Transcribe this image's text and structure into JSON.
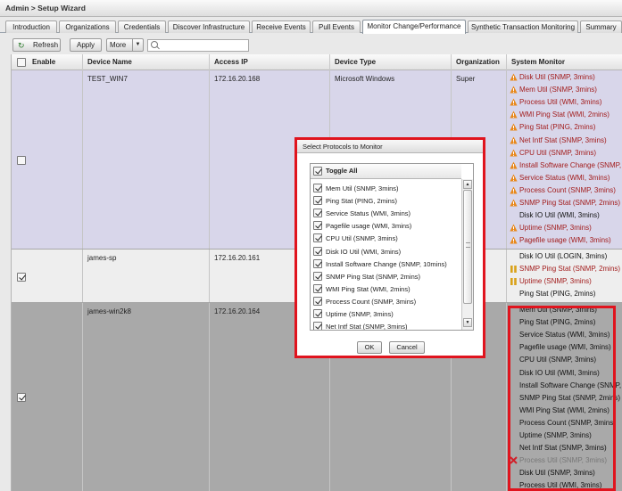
{
  "breadcrumb": "Admin > Setup Wizard",
  "tabs": [
    "Introduction",
    "Organizations",
    "Credentials",
    "Discover Infrastructure",
    "Receive Events",
    "Pull Events",
    "Monitor Change/Performance",
    "Synthetic Transaction Monitoring",
    "Summary"
  ],
  "active_tab": "Monitor Change/Performance",
  "toolbar": {
    "refresh_label": "Refresh",
    "apply_label": "Apply",
    "more_label": "More",
    "search_value": ""
  },
  "columns": {
    "enable": "Enable",
    "device_name": "Device Name",
    "access_ip": "Access IP",
    "device_type": "Device Type",
    "organization": "Organization",
    "system_monitor": "System Monitor"
  },
  "rows": [
    {
      "enabled": false,
      "device_name": "TEST_WIN7",
      "access_ip": "172.16.20.168",
      "device_type": "Microsoft Windows",
      "organization": "Super",
      "monitors": [
        {
          "label": "Disk Util (SNMP, 3mins)",
          "status": "warning"
        },
        {
          "label": "Mem Util (SNMP, 3mins)",
          "status": "warning"
        },
        {
          "label": "Process Util (WMI, 3mins)",
          "status": "warning"
        },
        {
          "label": "WMI Ping Stat (WMI, 2mins)",
          "status": "warning"
        },
        {
          "label": "Ping Stat (PING, 2mins)",
          "status": "warning"
        },
        {
          "label": "Net Intf Stat (SNMP, 3mins)",
          "status": "warning"
        },
        {
          "label": "CPU Util (SNMP, 3mins)",
          "status": "warning"
        },
        {
          "label": "Install Software Change (SNMP,",
          "status": "warning"
        },
        {
          "label": "Service Status (WMI, 3mins)",
          "status": "warning"
        },
        {
          "label": "Process Count (SNMP, 3mins)",
          "status": "warning"
        },
        {
          "label": "SNMP Ping Stat (SNMP, 2mins)",
          "status": "warning"
        },
        {
          "label": "Disk IO Util (WMI, 3mins)",
          "status": "ok"
        },
        {
          "label": "Uptime (SNMP, 3mins)",
          "status": "warning"
        },
        {
          "label": "Pagefile usage (WMI, 3mins)",
          "status": "warning"
        }
      ]
    },
    {
      "enabled": true,
      "device_name": "james-sp",
      "access_ip": "172.16.20.161",
      "device_type": "",
      "organization": "",
      "monitors": [
        {
          "label": "Disk IO Util (LOGIN, 3mins)",
          "status": "ok"
        },
        {
          "label": "SNMP Ping Stat (SNMP, 2mins)",
          "status": "paused"
        },
        {
          "label": "Uptime (SNMP, 3mins)",
          "status": "paused"
        },
        {
          "label": "Ping Stat (PING, 2mins)",
          "status": "ok"
        }
      ]
    },
    {
      "enabled": true,
      "device_name": "james-win2k8",
      "access_ip": "172.16.20.164",
      "device_type": "",
      "organization": "",
      "monitors": [
        {
          "label": "Mem Util (SNMP, 3mins)",
          "status": "ok"
        },
        {
          "label": "Ping Stat (PING, 2mins)",
          "status": "ok"
        },
        {
          "label": "Service Status (WMI, 3mins)",
          "status": "ok"
        },
        {
          "label": "Pagefile usage (WMI, 3mins)",
          "status": "ok"
        },
        {
          "label": "CPU Util (SNMP, 3mins)",
          "status": "ok"
        },
        {
          "label": "Disk IO Util (WMI, 3mins)",
          "status": "ok"
        },
        {
          "label": "Install Software Change (SNMP,",
          "status": "ok"
        },
        {
          "label": "SNMP Ping Stat (SNMP, 2mins)",
          "status": "ok"
        },
        {
          "label": "WMI Ping Stat (WMI, 2mins)",
          "status": "ok"
        },
        {
          "label": "Process Count (SNMP, 3mins)",
          "status": "ok"
        },
        {
          "label": "Uptime (SNMP, 3mins)",
          "status": "ok"
        },
        {
          "label": "Net Intf Stat (SNMP, 3mins)",
          "status": "ok"
        },
        {
          "label": "Process Util (SNMP, 3mins)",
          "status": "error"
        },
        {
          "label": "Disk Util (SNMP, 3mins)",
          "status": "ok"
        },
        {
          "label": "Process Util (WMI, 3mins)",
          "status": "ok"
        }
      ]
    }
  ],
  "dialog": {
    "title": "Select Protocols to Monitor",
    "toggle_all": "Toggle All",
    "items": [
      "Mem Util (SNMP, 3mins)",
      "Ping Stat (PING, 2mins)",
      "Service Status (WMI, 3mins)",
      "Pagefile usage (WMI, 3mins)",
      "CPU Util (SNMP, 3mins)",
      "Disk IO Util (WMI, 3mins)",
      "Install Software Change (SNMP, 10mins)",
      "SNMP Ping Stat (SNMP, 2mins)",
      "WMI Ping Stat (WMI, 2mins)",
      "Process Count (SNMP, 3mins)",
      "Uptime (SNMP, 3mins)",
      "Net Intf Stat (SNMP, 3mins)"
    ],
    "ok_label": "OK",
    "cancel_label": "Cancel"
  },
  "colors": {
    "warning": "#e8881a",
    "paused": "#d9a21a",
    "error": "#d0202a",
    "highlight": "#e0141e",
    "row_lavender": "#d8d6ea",
    "row_gray": "#a9a9a9",
    "row_light": "#eeeeee"
  }
}
